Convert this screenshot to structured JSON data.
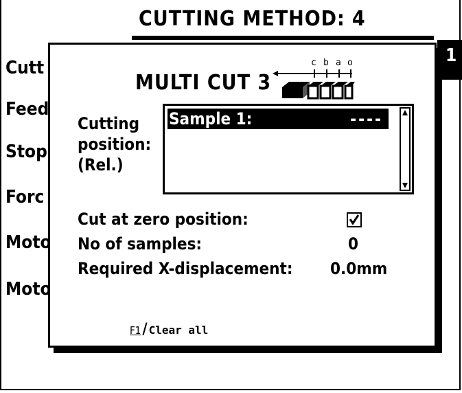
{
  "window": {
    "title": "CUTTING METHOD:",
    "method_number": "4",
    "tab_number": "1"
  },
  "background_labels": [
    "Cutt",
    "Feed",
    "Stop",
    "Forc",
    "Moto",
    "Moto"
  ],
  "dialog": {
    "title": "MULTI CUT 3",
    "diagram_letters": [
      "c",
      "b",
      "a",
      "o"
    ],
    "cutting_position_label": [
      "Cutting",
      "position:",
      "(Rel.)"
    ],
    "list": {
      "rows": [
        {
          "label": "Sample 1:",
          "value": "----"
        }
      ]
    },
    "fields": [
      {
        "label": "Cut at zero position:",
        "value": "checked"
      },
      {
        "label": "No of samples:",
        "value": "0"
      },
      {
        "label": "Required X-displacement:",
        "value": "0.0mm"
      }
    ],
    "footer": {
      "key": "F1",
      "action": "Clear all"
    }
  }
}
